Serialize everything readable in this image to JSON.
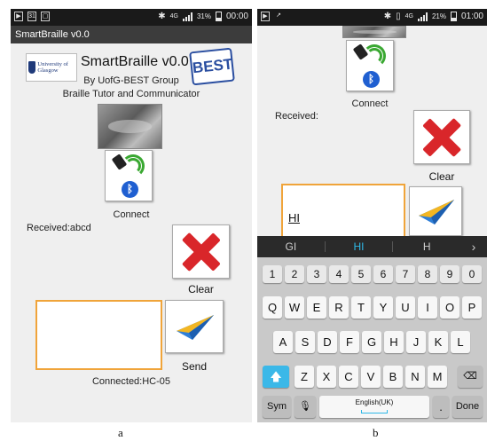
{
  "panel_a": {
    "status_bar": {
      "battery": "31%",
      "time": "00:00",
      "network": "4G"
    },
    "app_title": "SmartBraille v0.0",
    "logo_left_text": "University of Glasgow",
    "logo_right_text": "BEST",
    "heading": "SmartBraille v0.0",
    "byline": "By UofG-BEST Group",
    "subtitle": "Braille Tutor and Communicator",
    "connect_label": "Connect",
    "received_text": "Received:abcd",
    "clear_label": "Clear",
    "send_label": "Send",
    "input_value": "",
    "connection_status": "Connected:HC-05"
  },
  "panel_b": {
    "status_bar": {
      "battery": "21%",
      "time": "01:00",
      "network": "4G"
    },
    "connect_label": "Connect",
    "received_text": "Received:",
    "clear_label": "Clear",
    "input_value": "HI",
    "suggestions": [
      "GI",
      "HI",
      "H"
    ],
    "number_row": [
      "1",
      "2",
      "3",
      "4",
      "5",
      "6",
      "7",
      "8",
      "9",
      "0"
    ],
    "row1": [
      "Q",
      "W",
      "E",
      "R",
      "T",
      "Y",
      "U",
      "I",
      "O",
      "P"
    ],
    "row2": [
      "A",
      "S",
      "D",
      "F",
      "G",
      "H",
      "J",
      "K",
      "L"
    ],
    "row3": [
      "Z",
      "X",
      "C",
      "V",
      "B",
      "N",
      "M"
    ],
    "sym_label": "Sym",
    "space_label": "English(UK)",
    "period_label": ".",
    "done_label": "Done"
  },
  "captions": {
    "a": "a",
    "b": "b"
  },
  "colors": {
    "input_border": "#f0a43a",
    "clear_x": "#d9262a",
    "bluetooth": "#1f5fd1",
    "suggestion_highlight": "#2fb8e6"
  }
}
